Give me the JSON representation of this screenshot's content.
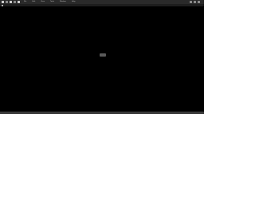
{
  "menubar": {
    "menus": [
      "File",
      "Edit",
      "View",
      "Tools",
      "Window",
      "Help"
    ],
    "status_left": "",
    "status_right": "",
    "colors": {
      "bar_bg": "#2a2a2a",
      "text": "#c8c8c8"
    }
  },
  "tabbar": {
    "tab_label": "",
    "bg": "#1e1e1e"
  },
  "main": {
    "center_label": "",
    "bg": "#000000",
    "center_pill_bg": "#5a5a5a"
  },
  "icons": [
    "apple-icon",
    "app-icon",
    "bolt-icon",
    "grid-icon",
    "app2-icon",
    "search-icon",
    "wifi-icon",
    "battery-icon"
  ]
}
